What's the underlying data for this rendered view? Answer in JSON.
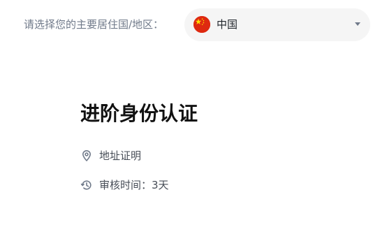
{
  "region": {
    "label": "请选择您的主要居住国/地区：",
    "selected": "中国",
    "flag_icon": "china-flag-icon",
    "dropdown_icon": "caret-down-icon"
  },
  "section": {
    "title": "进阶身份认证",
    "items": [
      {
        "icon": "location-pin-icon",
        "text": "地址证明"
      },
      {
        "icon": "clock-history-icon",
        "text": "审核时间：3天"
      }
    ]
  },
  "colors": {
    "muted_text": "#707a8a",
    "body_text": "#474d57",
    "title_text": "#111111",
    "select_bg": "#f5f5f5",
    "flag_red": "#de2910",
    "flag_star": "#ffde00"
  }
}
